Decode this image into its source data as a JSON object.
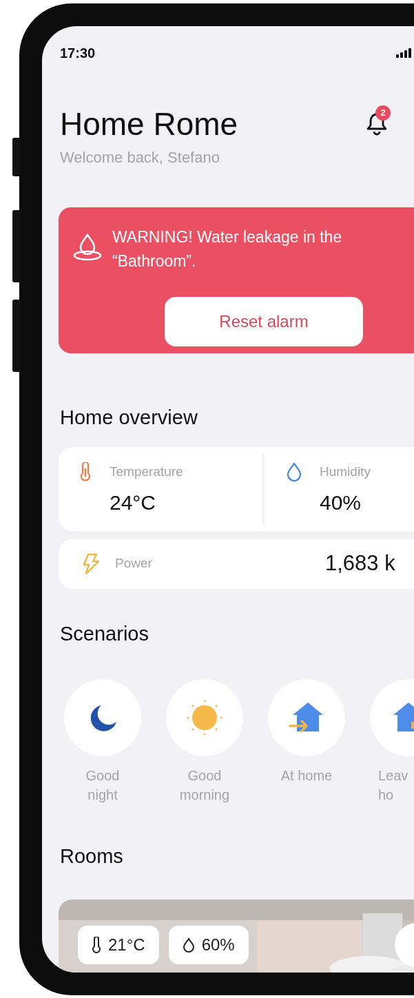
{
  "status_bar": {
    "time": "17:30"
  },
  "header": {
    "title": "Home Rome",
    "subtitle": "Welcome back, Stefano",
    "notification_count": "2"
  },
  "alert": {
    "message": "WARNING! Water leakage in the “Bathroom”.",
    "button": "Reset alarm"
  },
  "overview": {
    "title": "Home overview",
    "stats": [
      {
        "kind": "temperature",
        "label": "Temperature",
        "value": "24°C"
      },
      {
        "kind": "humidity",
        "label": "Humidity",
        "value": "40%"
      }
    ],
    "power": {
      "label": "Power",
      "value": "1,683 k"
    }
  },
  "scenarios": {
    "title": "Scenarios",
    "items": [
      {
        "kind": "night",
        "label": "Good\nnight"
      },
      {
        "kind": "morning",
        "label": "Good\nmorning"
      },
      {
        "kind": "arrive",
        "label": "At home"
      },
      {
        "kind": "leave",
        "label": "Leav\nho"
      }
    ]
  },
  "rooms": {
    "title": "Rooms",
    "cards": [
      {
        "kind": "picture",
        "temperature": "21°C",
        "humidity": "60%"
      }
    ]
  }
}
